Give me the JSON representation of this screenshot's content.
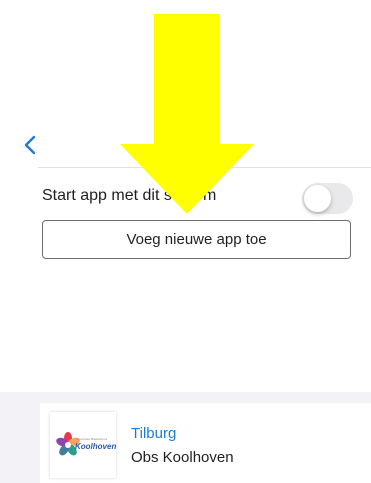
{
  "nav": {
    "back_icon": "chevron-left-icon",
    "title": "",
    "accent_color": "#1e7ad3"
  },
  "settings": {
    "start_app_label": "Start app met dit scherm",
    "start_app_toggle_on": false,
    "add_app_button_label": "Voeg nieuwe app toe"
  },
  "school_card": {
    "city": "Tilburg",
    "name": "Obs Koolhoven",
    "logo": {
      "small_text": "Openbare Basisschool",
      "main_text": "Koolhoven"
    }
  },
  "overlay": {
    "arrow_icon": "arrow-down-icon",
    "arrow_color": "#ffff00"
  }
}
